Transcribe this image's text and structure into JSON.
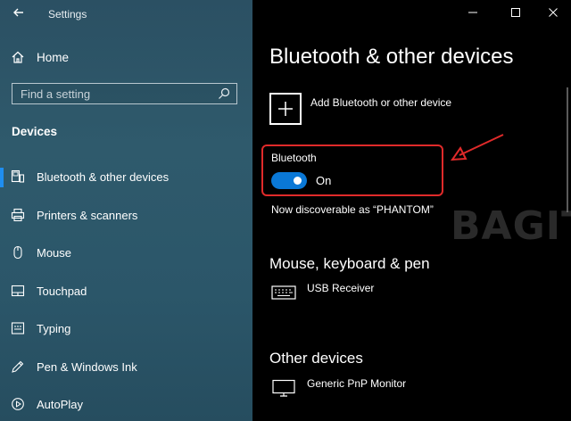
{
  "window": {
    "app_title": "Settings"
  },
  "sidebar": {
    "home_label": "Home",
    "search_placeholder": "Find a setting",
    "section_title": "Devices",
    "items": [
      {
        "label": "Bluetooth & other devices",
        "icon": "bluetooth-devices-icon",
        "active": true
      },
      {
        "label": "Printers & scanners",
        "icon": "printer-icon"
      },
      {
        "label": "Mouse",
        "icon": "mouse-icon"
      },
      {
        "label": "Touchpad",
        "icon": "touchpad-icon"
      },
      {
        "label": "Typing",
        "icon": "keyboard-icon"
      },
      {
        "label": "Pen & Windows Ink",
        "icon": "pen-icon"
      },
      {
        "label": "AutoPlay",
        "icon": "autoplay-icon"
      }
    ]
  },
  "main": {
    "page_title": "Bluetooth & other devices",
    "add_device_label": "Add Bluetooth or other device",
    "bluetooth": {
      "label": "Bluetooth",
      "state": "On",
      "enabled": true
    },
    "discoverable_text": "Now discoverable as “PHANTOM”",
    "sections": {
      "mouse_keyboard_pen": {
        "title": "Mouse, keyboard & pen",
        "devices": [
          {
            "label": "USB Receiver",
            "icon": "keyboard-icon"
          }
        ]
      },
      "other_devices": {
        "title": "Other devices",
        "devices": [
          {
            "label": "Generic PnP Monitor",
            "icon": "monitor-icon"
          }
        ]
      }
    }
  },
  "watermark": "BAGITEKNO",
  "colors": {
    "accent": "#0a78d6",
    "highlight": "#e02a2a",
    "sidebar_bg": "#2b5669"
  }
}
